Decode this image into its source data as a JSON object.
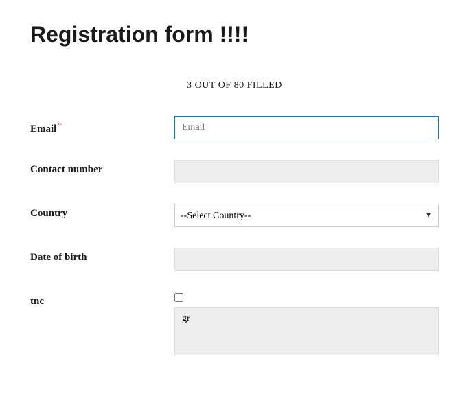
{
  "title": "Registration form !!!!",
  "status": "3 OUT OF 80 FILLED",
  "fields": {
    "email": {
      "label": "Email",
      "placeholder": "Email",
      "required_mark": "*"
    },
    "contact": {
      "label": "Contact number"
    },
    "country": {
      "label": "Country",
      "selected": "--Select Country--"
    },
    "dob": {
      "label": "Date of birth"
    },
    "tnc": {
      "label": "tnc",
      "textarea_value": "gr"
    }
  }
}
